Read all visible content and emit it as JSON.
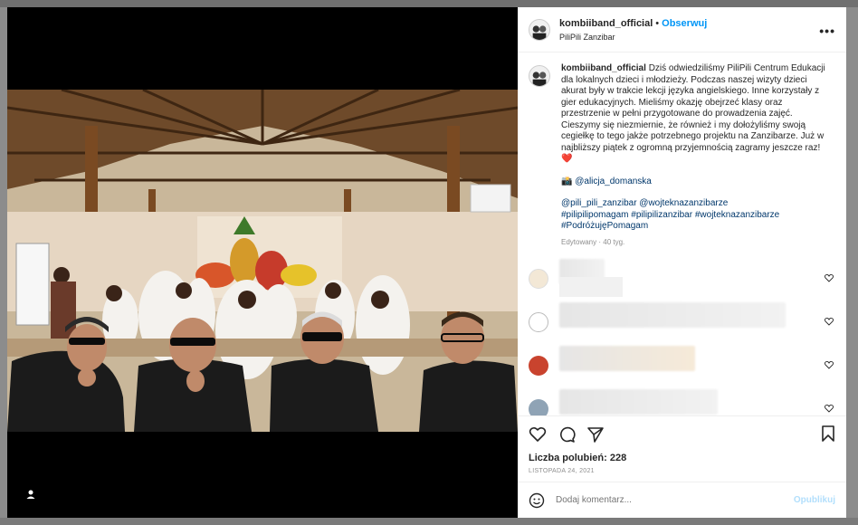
{
  "post": {
    "username": "kombiiband_official",
    "dot": "•",
    "follow_label": "Obserwuj",
    "location": "PiliPili Zanzibar",
    "more_label": "•••",
    "caption_text": "Dziś odwiedziliśmy PiliPili Centrum Edukacji dla lokalnych dzieci i młodzieży. Podczas naszej wizyty dzieci akurat były w trakcie lekcji języka angielskiego. Inne korzystały z gier edukacyjnych. Mieliśmy okazję obejrzeć klasy oraz przestrzenie w pełni przygotowane do prowadzenia zajęć. Cieszymy się niezmiernie, że również i my dołożyliśmy swoją cegiełkę to tego jakże potrzebnego projektu na Zanzibarze. Już w najbliższy piątek z ogromną przyjemnością zagramy jeszcze raz!",
    "caption_emoji": "❤️",
    "photo_credit_emoji": "📸",
    "photo_credit": "@alicja_domanska",
    "mentions": "@pili_pili_zanzibar @wojteknazanzibarze",
    "hashtags": "#pilipilipomagam #pilipilizanzibar #wojteknazanzibarze #PodróżujęPomagam",
    "edited": "Edytowany · 40 tyg.",
    "likes": "Liczba polubień: 228",
    "date": "LISTOPADA 24, 2021",
    "comment_placeholder": "Dodaj komentarz...",
    "publish_label": "Opublikuj"
  },
  "icons": {
    "heart": "heart-icon",
    "comment": "comment-icon",
    "share": "share-icon",
    "bookmark": "bookmark-icon",
    "emoji": "emoji-icon",
    "tag": "user-tag-icon"
  },
  "colors": {
    "accent": "#0095f6",
    "publish_disabled": "#b2dffc",
    "text": "#262626",
    "muted": "#8e8e8e"
  }
}
